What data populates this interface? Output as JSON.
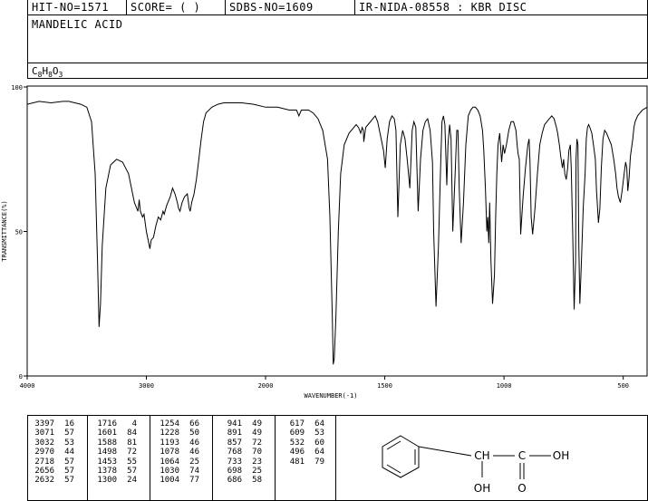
{
  "header": {
    "hit_no": "HIT-NO=1571",
    "score": "SCORE=  (   )",
    "sdbs_no": "SDBS-NO=1609",
    "ir_id": "IR-NIDA-08558 : KBR DISC"
  },
  "compound_name": "MANDELIC ACID",
  "formula": {
    "c": "C",
    "c_n": "8",
    "h": "H",
    "h_n": "8",
    "o": "O",
    "o_n": "3"
  },
  "chart_data": {
    "type": "line",
    "title": "",
    "xlabel": "WAVENUMBER(-1)",
    "ylabel": "TRANSMITTANCE(%)",
    "xlim": [
      4000,
      400
    ],
    "ylim": [
      0,
      100
    ],
    "x_ticks": [
      4000,
      3000,
      2000,
      1500,
      1000,
      500
    ],
    "y_ticks": [
      0,
      50,
      100
    ],
    "grid": false,
    "series": [
      {
        "name": "",
        "x": [
          4000,
          3900,
          3800,
          3700,
          3650,
          3600,
          3550,
          3500,
          3460,
          3430,
          3410,
          3397,
          3385,
          3370,
          3340,
          3300,
          3250,
          3200,
          3150,
          3100,
          3071,
          3060,
          3050,
          3032,
          3020,
          3010,
          3000,
          2985,
          2970,
          2960,
          2940,
          2920,
          2900,
          2880,
          2860,
          2850,
          2830,
          2800,
          2780,
          2760,
          2740,
          2730,
          2718,
          2700,
          2680,
          2656,
          2640,
          2632,
          2620,
          2600,
          2580,
          2560,
          2540,
          2520,
          2500,
          2450,
          2400,
          2350,
          2300,
          2200,
          2100,
          2000,
          1950,
          1900,
          1870,
          1860,
          1850,
          1820,
          1800,
          1780,
          1760,
          1740,
          1730,
          1720,
          1716,
          1712,
          1705,
          1695,
          1685,
          1670,
          1650,
          1630,
          1620,
          1610,
          1601,
          1595,
          1590,
          1588,
          1580,
          1570,
          1560,
          1550,
          1540,
          1530,
          1515,
          1505,
          1498,
          1490,
          1480,
          1470,
          1460,
          1453,
          1445,
          1435,
          1425,
          1415,
          1405,
          1395,
          1385,
          1378,
          1370,
          1360,
          1350,
          1340,
          1330,
          1320,
          1310,
          1300,
          1295,
          1285,
          1275,
          1265,
          1260,
          1254,
          1248,
          1240,
          1235,
          1228,
          1222,
          1215,
          1205,
          1198,
          1193,
          1188,
          1180,
          1170,
          1160,
          1150,
          1140,
          1130,
          1120,
          1110,
          1100,
          1090,
          1085,
          1078,
          1072,
          1068,
          1064,
          1060,
          1055,
          1048,
          1040,
          1035,
          1030,
          1025,
          1018,
          1010,
          1004,
          998,
          990,
          980,
          970,
          960,
          950,
          945,
          941,
          936,
          930,
          920,
          910,
          900,
          895,
          891,
          886,
          880,
          870,
          860,
          850,
          840,
          830,
          820,
          810,
          800,
          790,
          780,
          775,
          768,
          762,
          755,
          750,
          745,
          739,
          733,
          728,
          722,
          718,
          712,
          706,
          700,
          698,
          694,
          690,
          686,
          682,
          675,
          668,
          660,
          655,
          650,
          645,
          640,
          632,
          625,
          617,
          612,
          609,
          604,
          598,
          592,
          585,
          578,
          570,
          560,
          550,
          540,
          532,
          526,
          520,
          512,
          505,
          496,
          490,
          485,
          481,
          476,
          470,
          465,
          460,
          455,
          450,
          440,
          430,
          420,
          410,
          400
        ],
        "values": [
          94,
          95,
          94.5,
          95,
          95,
          94.5,
          94,
          93,
          88,
          70,
          40,
          17,
          25,
          45,
          65,
          73,
          75,
          74,
          70,
          60,
          57,
          61,
          57,
          55,
          56,
          53,
          50,
          47,
          44,
          47,
          48,
          52,
          55,
          54,
          57,
          56,
          59,
          62,
          65,
          63,
          60,
          58,
          57,
          60,
          62,
          63,
          58,
          57,
          60,
          63,
          68,
          75,
          82,
          88,
          91,
          93,
          94,
          94.5,
          94.5,
          94.5,
          94,
          93,
          93,
          92,
          92,
          90,
          92,
          92,
          91,
          89,
          85,
          75,
          55,
          20,
          4,
          6,
          20,
          50,
          70,
          80,
          84,
          86,
          87,
          86,
          84,
          86,
          85,
          81,
          86,
          87,
          88,
          89,
          90,
          88,
          82,
          78,
          72,
          82,
          88,
          90,
          89,
          85,
          55,
          80,
          85,
          82,
          74,
          65,
          85,
          88,
          86,
          57,
          75,
          85,
          88,
          89,
          85,
          74,
          50,
          24,
          45,
          75,
          88,
          90,
          87,
          66,
          80,
          87,
          82,
          50,
          70,
          85,
          85,
          65,
          46,
          60,
          80,
          90,
          92,
          93,
          93,
          92,
          90,
          85,
          78,
          65,
          50,
          55,
          46,
          60,
          40,
          25,
          35,
          55,
          70,
          80,
          84,
          74,
          80,
          77,
          80,
          85,
          88,
          88,
          85,
          80,
          77,
          75,
          49,
          62,
          72,
          80,
          82,
          74,
          55,
          49,
          58,
          70,
          80,
          84,
          87,
          88,
          89,
          90,
          89,
          86,
          84,
          80,
          76,
          72,
          75,
          70,
          68,
          72,
          78,
          80,
          72,
          50,
          23,
          40,
          75,
          82,
          80,
          45,
          25,
          40,
          58,
          70,
          82,
          86,
          87,
          86,
          84,
          80,
          75,
          64,
          60,
          53,
          58,
          72,
          82,
          85,
          84,
          82,
          80,
          75,
          70,
          65,
          62,
          60,
          64,
          70,
          74,
          72,
          64,
          68,
          76,
          79,
          82,
          86,
          88,
          90,
          91,
          92,
          92.5,
          93
        ]
      }
    ]
  },
  "peak_columns": [
    [
      {
        "wn": "3397",
        "t": "16"
      },
      {
        "wn": "3071",
        "t": "57"
      },
      {
        "wn": "3032",
        "t": "53"
      },
      {
        "wn": "2970",
        "t": "44"
      },
      {
        "wn": "2718",
        "t": "57"
      },
      {
        "wn": "2656",
        "t": "57"
      },
      {
        "wn": "2632",
        "t": "57"
      }
    ],
    [
      {
        "wn": "1716",
        "t": "4"
      },
      {
        "wn": "1601",
        "t": "84"
      },
      {
        "wn": "1588",
        "t": "81"
      },
      {
        "wn": "1498",
        "t": "72"
      },
      {
        "wn": "1453",
        "t": "55"
      },
      {
        "wn": "1378",
        "t": "57"
      },
      {
        "wn": "1300",
        "t": "24"
      }
    ],
    [
      {
        "wn": "1254",
        "t": "66"
      },
      {
        "wn": "1228",
        "t": "50"
      },
      {
        "wn": "1193",
        "t": "46"
      },
      {
        "wn": "1078",
        "t": "46"
      },
      {
        "wn": "1064",
        "t": "25"
      },
      {
        "wn": "1030",
        "t": "74"
      },
      {
        "wn": "1004",
        "t": "77"
      }
    ],
    [
      {
        "wn": "941",
        "t": "49"
      },
      {
        "wn": "891",
        "t": "49"
      },
      {
        "wn": "857",
        "t": "72"
      },
      {
        "wn": "768",
        "t": "70"
      },
      {
        "wn": "733",
        "t": "23"
      },
      {
        "wn": "698",
        "t": "25"
      },
      {
        "wn": "686",
        "t": "58"
      }
    ],
    [
      {
        "wn": "617",
        "t": "64"
      },
      {
        "wn": "609",
        "t": "53"
      },
      {
        "wn": "532",
        "t": "60"
      },
      {
        "wn": "496",
        "t": "64"
      },
      {
        "wn": "481",
        "t": "79"
      }
    ]
  ],
  "structure_labels": {
    "ch": "CH",
    "c": "C",
    "oh_top": "OH",
    "oh_bottom": "OH",
    "o": "O"
  }
}
